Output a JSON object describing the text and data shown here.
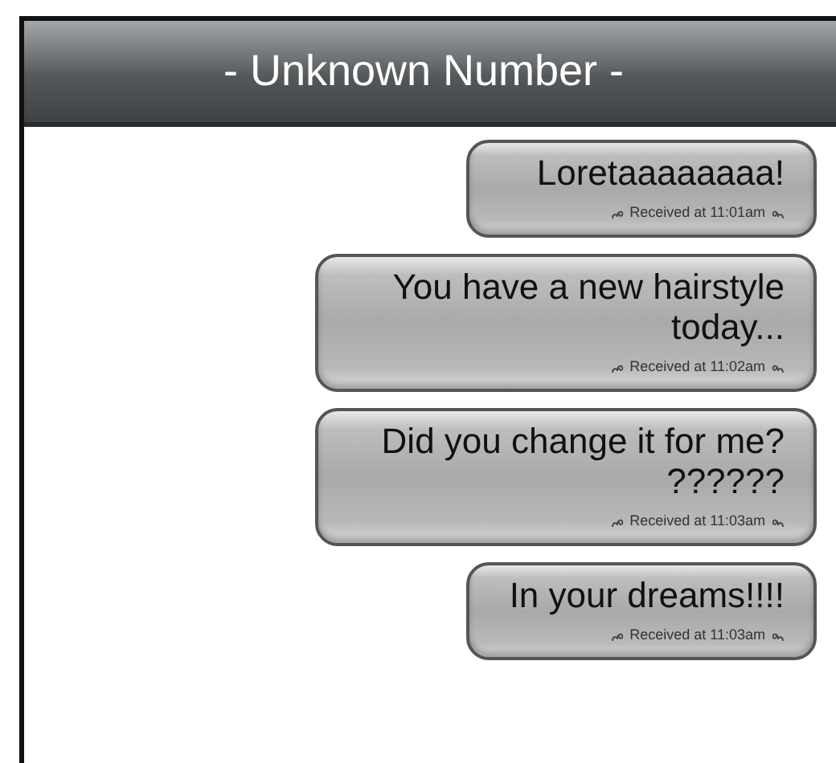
{
  "header": {
    "title": "- Unknown Number -"
  },
  "messages": [
    {
      "text": "Loretaaaaaaaa!",
      "status": "Received at 11:01am"
    },
    {
      "text": "You have a new hairstyle today...",
      "status": "Received at 11:02am"
    },
    {
      "text": "Did you change it for me? ??????",
      "status": "Received at 11:03am"
    },
    {
      "text": "In your dreams!!!!",
      "status": "Received at 11:03am"
    }
  ]
}
